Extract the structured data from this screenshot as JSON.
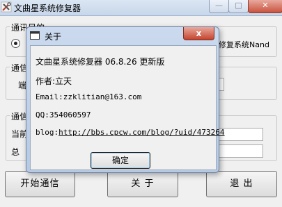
{
  "main_window": {
    "title": "文曲星系统修复器",
    "group_purpose": {
      "legend": "通讯目的",
      "radio_right_label": "修复系统Nand"
    },
    "group_port": {
      "legend": "通信",
      "label": "端"
    },
    "group_status": {
      "legend": "通信",
      "current_label": "当前",
      "total_label": "总"
    },
    "buttons": {
      "start": "开始通信",
      "about": "关 于",
      "exit": "退 出"
    }
  },
  "about_dialog": {
    "title": "关于",
    "close_glyph": "x",
    "product_line": "文曲星系统修复器 06.8.26 更新版",
    "author_line": "作者:立天",
    "email_line": "Email:zzklitian@163.com",
    "qq_line": "QQ:354060597",
    "blog_label": "blog:",
    "blog_url": "http://bbs.cpcw.com/blog/?uid/473264",
    "ok_label": "确定"
  }
}
